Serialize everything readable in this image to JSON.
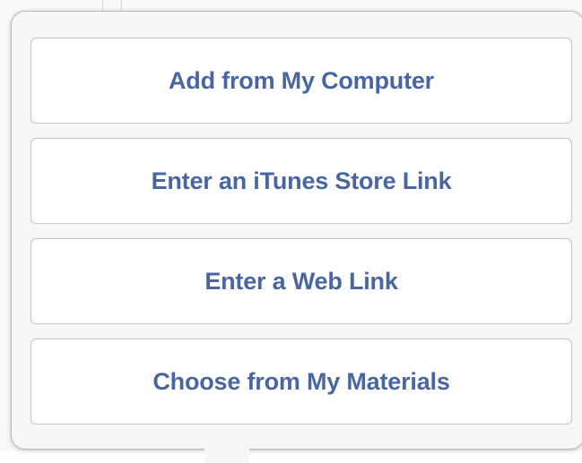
{
  "popover": {
    "options": [
      {
        "label": "Add from My Computer"
      },
      {
        "label": "Enter an iTunes Store Link"
      },
      {
        "label": "Enter a Web Link"
      },
      {
        "label": "Choose from My Materials"
      }
    ]
  },
  "colors": {
    "button_text": "#4a66a0",
    "button_border": "#c4c4c4",
    "popover_background": "#f7f7f7"
  }
}
